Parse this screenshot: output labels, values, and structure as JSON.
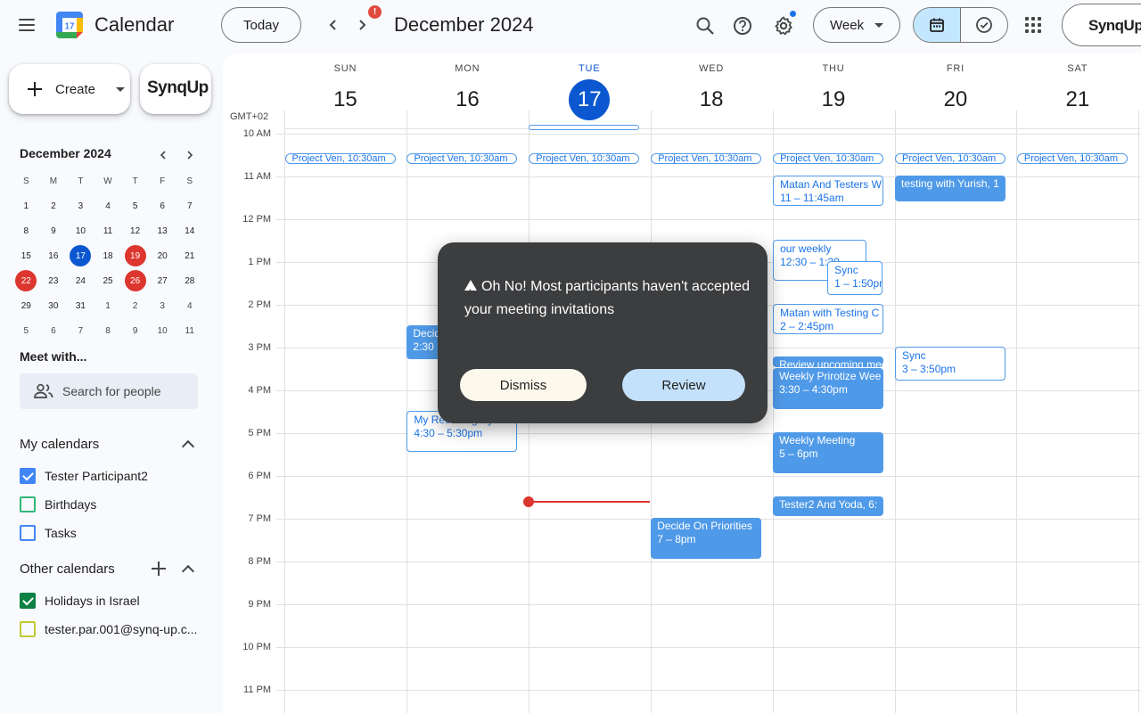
{
  "header": {
    "app_title": "Calendar",
    "logo_day": "17",
    "today_label": "Today",
    "nav_badge": "!",
    "period_title": "December 2024",
    "view_label": "Week",
    "synq_label": "SynqUp"
  },
  "sidebar": {
    "create_label": "Create",
    "synq_label": "SynqUp",
    "mini_calendar": {
      "title": "December 2024",
      "weekdays": [
        "S",
        "M",
        "T",
        "W",
        "T",
        "F",
        "S"
      ],
      "weeks": [
        [
          "1",
          "2",
          "3",
          "4",
          "5",
          "6",
          "7"
        ],
        [
          "8",
          "9",
          "10",
          "11",
          "12",
          "13",
          "14"
        ],
        [
          "15",
          "16",
          "17",
          "18",
          "19",
          "20",
          "21"
        ],
        [
          "22",
          "23",
          "24",
          "25",
          "26",
          "27",
          "28"
        ],
        [
          "29",
          "30",
          "31",
          "1",
          "2",
          "3",
          "4"
        ],
        [
          "5",
          "6",
          "7",
          "8",
          "9",
          "10",
          "11"
        ]
      ],
      "today": "17",
      "holidays": [
        "19",
        "22",
        "26"
      ]
    },
    "meet_with_title": "Meet with...",
    "search_people_placeholder": "Search for people",
    "my_calendars_title": "My calendars",
    "my_calendars": [
      {
        "label": "Tester Participant2",
        "checked": true,
        "color": "#4285f4"
      },
      {
        "label": "Birthdays",
        "checked": false,
        "color": "#33b679"
      },
      {
        "label": "Tasks",
        "checked": false,
        "color": "#4285f4"
      }
    ],
    "other_calendars_title": "Other calendars",
    "other_calendars": [
      {
        "label": "Holidays in Israel",
        "checked": true,
        "color": "#0b8043"
      },
      {
        "label": "tester.par.001@synq-up.c...",
        "checked": false,
        "color": "#c0ca33"
      }
    ]
  },
  "week": {
    "timezone": "GMT+02",
    "days": [
      {
        "dow": "SUN",
        "num": "15",
        "today": false
      },
      {
        "dow": "MON",
        "num": "16",
        "today": false
      },
      {
        "dow": "TUE",
        "num": "17",
        "today": true
      },
      {
        "dow": "WED",
        "num": "18",
        "today": false
      },
      {
        "dow": "THU",
        "num": "19",
        "today": false
      },
      {
        "dow": "FRI",
        "num": "20",
        "today": false
      },
      {
        "dow": "SAT",
        "num": "21",
        "today": false
      }
    ],
    "hours": [
      "10 AM",
      "11 AM",
      "12 PM",
      "1 PM",
      "2 PM",
      "3 PM",
      "4 PM",
      "5 PM",
      "6 PM",
      "7 PM",
      "8 PM",
      "9 PM",
      "10 PM",
      "11 PM"
    ],
    "events": [
      {
        "day": 0,
        "title": "Project Ven, 10:30am",
        "time": "",
        "style": "pill"
      },
      {
        "day": 1,
        "title": "Project Ven, 10:30am",
        "time": "",
        "style": "pill"
      },
      {
        "day": 2,
        "title": "Project Ven, 10:30am",
        "time": "",
        "style": "pill"
      },
      {
        "day": 3,
        "title": "Project Ven, 10:30am",
        "time": "",
        "style": "pill"
      },
      {
        "day": 4,
        "title": "Project Ven, 10:30am",
        "time": "",
        "style": "pill"
      },
      {
        "day": 5,
        "title": "Project Ven, 10:30am",
        "time": "",
        "style": "pill"
      },
      {
        "day": 6,
        "title": "Project Ven, 10:30am",
        "time": "",
        "style": "pill"
      },
      {
        "day": 4,
        "title": "Matan And Testers W",
        "time": "11 – 11:45am",
        "style": "outline"
      },
      {
        "day": 5,
        "title": "testing with Yurish, 1",
        "time": "",
        "style": "filled"
      },
      {
        "day": 4,
        "title": "our weekly",
        "time": "12:30 – 1:30",
        "style": "outline"
      },
      {
        "day": 4,
        "title": "Sync",
        "time": "1 – 1:50pm",
        "style": "outline"
      },
      {
        "day": 4,
        "title": "Matan with Testing C",
        "time": "2 – 2:45pm",
        "style": "outline"
      },
      {
        "day": 1,
        "title": "Decide",
        "time": "2:30",
        "style": "filled"
      },
      {
        "day": 5,
        "title": "Sync",
        "time": "3 – 3:50pm",
        "style": "outline"
      },
      {
        "day": 4,
        "title": "Review upcoming mee",
        "time": "",
        "style": "filled"
      },
      {
        "day": 4,
        "title": "Weekly Prirotize Wee",
        "time": "3:30 – 4:30pm",
        "style": "filled"
      },
      {
        "day": 1,
        "title": "My Recurring Sync",
        "time": "4:30 – 5:30pm",
        "style": "outline"
      },
      {
        "day": 4,
        "title": "Weekly Meeting",
        "time": "5 – 6pm",
        "style": "filled"
      },
      {
        "day": 4,
        "title": "Tester2 And Yoda, 6:",
        "time": "",
        "style": "filled"
      },
      {
        "day": 3,
        "title": "Decide On Priorities",
        "time": "7 – 8pm",
        "style": "filled"
      }
    ]
  },
  "modal": {
    "message": "Oh No! Most participants haven't accepted your meeting invitations",
    "dismiss_label": "Dismiss",
    "review_label": "Review"
  }
}
